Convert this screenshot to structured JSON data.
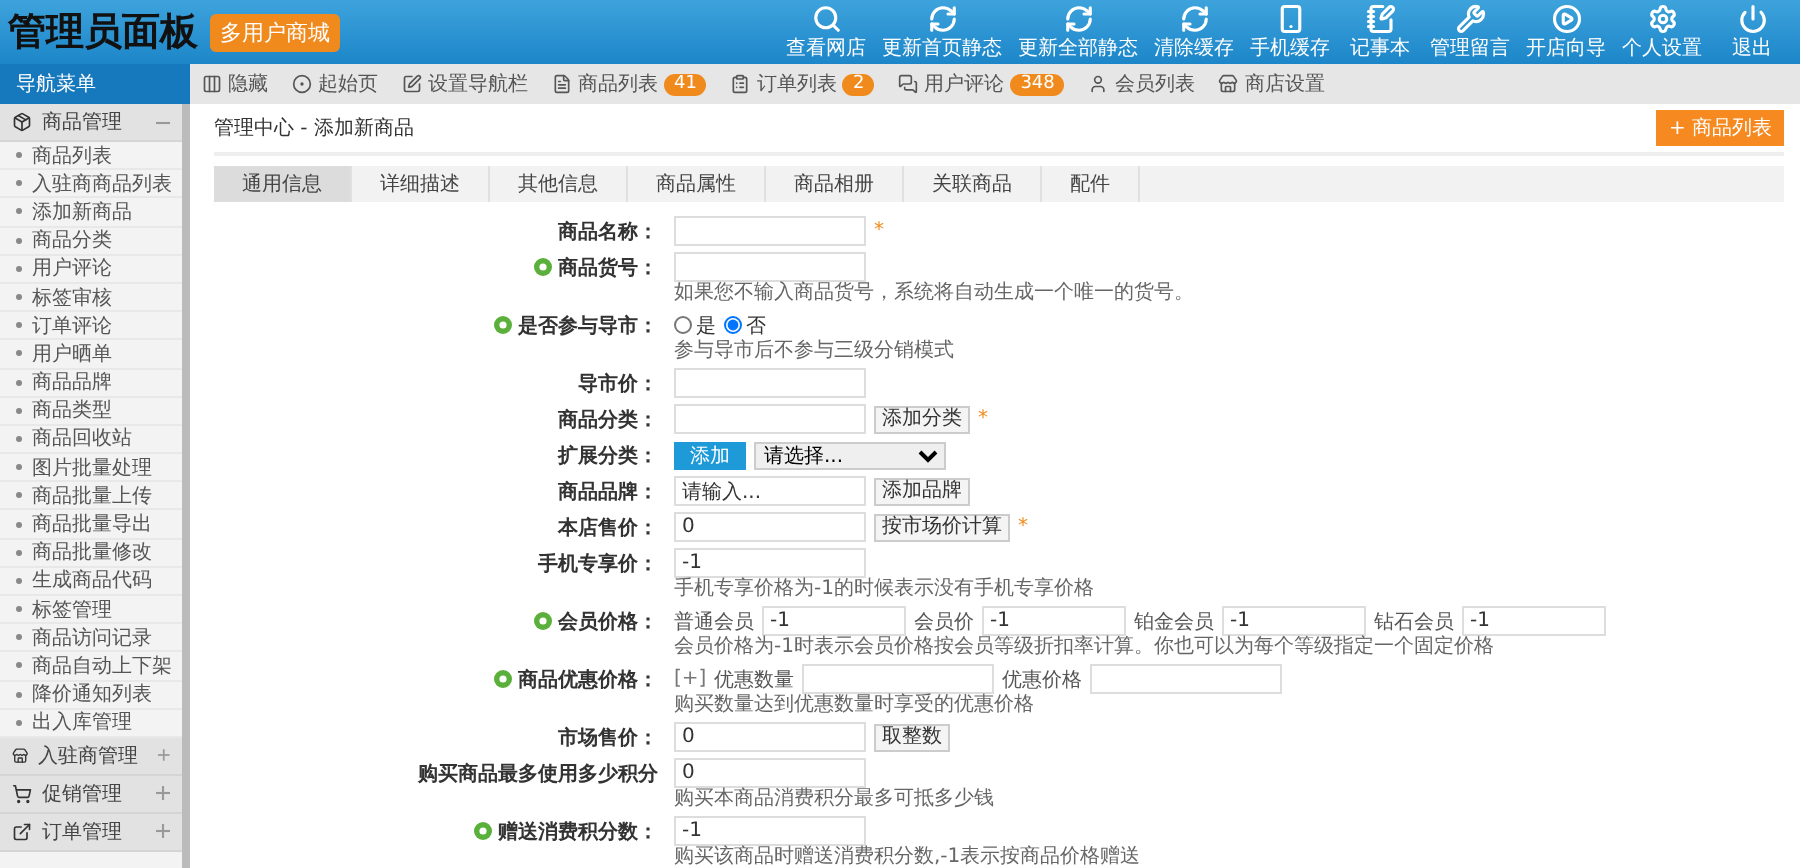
{
  "header": {
    "title": "管理员面板",
    "badge": "多用户商城",
    "actions": [
      {
        "kind": "search",
        "label": "查看网店"
      },
      {
        "kind": "refresh",
        "label": "更新首页静态"
      },
      {
        "kind": "refresh",
        "label": "更新全部静态"
      },
      {
        "kind": "refresh",
        "label": "清除缓存"
      },
      {
        "kind": "phone",
        "label": "手机缓存"
      },
      {
        "kind": "note",
        "label": "记事本"
      },
      {
        "kind": "wrench",
        "label": "管理留言"
      },
      {
        "kind": "play",
        "label": "开店向导"
      },
      {
        "kind": "gear",
        "label": "个人设置"
      },
      {
        "kind": "power",
        "label": "退出"
      }
    ]
  },
  "nav_title": "导航菜单",
  "toolbar": [
    {
      "kind": "hide",
      "label": "隐藏"
    },
    {
      "kind": "home",
      "label": "起始页"
    },
    {
      "kind": "edit",
      "label": "设置导航栏"
    },
    {
      "kind": "list",
      "label": "商品列表",
      "count": "41"
    },
    {
      "kind": "order",
      "label": "订单列表",
      "count": "2"
    },
    {
      "kind": "chat",
      "label": "用户评论",
      "count": "348"
    },
    {
      "kind": "member",
      "label": "会员列表"
    },
    {
      "kind": "shop",
      "label": "商店设置"
    }
  ],
  "sidebar": [
    {
      "kind": "goods",
      "title": "商品管理",
      "expanded": true,
      "items": [
        "商品列表",
        "入驻商商品列表",
        "添加新商品",
        "商品分类",
        "用户评论",
        "标签审核",
        "订单评论",
        "用户晒单",
        "商品品牌",
        "商品类型",
        "商品回收站",
        "图片批量处理",
        "商品批量上传",
        "商品批量导出",
        "商品批量修改",
        "生成商品代码",
        "标签管理",
        "商品访问记录",
        "商品自动上下架",
        "降价通知列表",
        "出入库管理"
      ]
    },
    {
      "kind": "store",
      "title": "入驻商管理",
      "expanded": false
    },
    {
      "kind": "cart",
      "title": "促销管理",
      "expanded": false
    },
    {
      "kind": "order",
      "title": "订单管理",
      "expanded": false
    }
  ],
  "breadcrumb": "管理中心 - 添加新商品",
  "list_button": "+ 商品列表",
  "tabs": [
    {
      "label": "通用信息",
      "selected": true
    },
    {
      "label": "详细描述",
      "selected": false
    },
    {
      "label": "其他信息",
      "selected": false
    },
    {
      "label": "商品属性",
      "selected": false
    },
    {
      "label": "商品相册",
      "selected": false
    },
    {
      "label": "关联商品",
      "selected": false
    },
    {
      "label": "配件",
      "selected": false
    }
  ],
  "form": [
    {
      "kind": "text",
      "label": "商品名称：",
      "help": false,
      "mark": "*"
    },
    {
      "kind": "text",
      "label": "商品货号：",
      "help": true,
      "hint": "如果您不输入商品货号，系统将自动生成一个唯一的货号。"
    },
    {
      "kind": "radio",
      "label": "是否参与导市：",
      "help": true,
      "options": [
        {
          "label": "是",
          "selected": false
        },
        {
          "label": "否",
          "selected": true
        }
      ],
      "hint": "参与导市后不参与三级分销模式"
    },
    {
      "kind": "text",
      "label": "导市价：",
      "help": false
    },
    {
      "kind": "text",
      "label": "商品分类：",
      "help": false,
      "button": "添加分类",
      "mark": "*"
    },
    {
      "kind": "select",
      "label": "扩展分类：",
      "help": false,
      "button": "添加",
      "value": "请选择..."
    },
    {
      "kind": "text",
      "label": "商品品牌：",
      "help": false,
      "value": "请输入...",
      "button": "添加品牌"
    },
    {
      "kind": "text",
      "label": "本店售价：",
      "help": false,
      "value": "0",
      "button": "按市场价计算",
      "mark": "*"
    },
    {
      "kind": "text",
      "label": "手机专享价：",
      "help": false,
      "value": "-1",
      "hint": "手机专享价格为-1的时候表示没有手机专享价格"
    },
    {
      "kind": "member",
      "label": "会员价格：",
      "help": true,
      "levels": [
        {
          "label": "普通会员",
          "value": "-1"
        },
        {
          "label": "会员价",
          "value": "-1"
        },
        {
          "label": "铂金会员",
          "value": "-1"
        },
        {
          "label": "钻石会员",
          "value": "-1"
        }
      ],
      "hint": "会员价格为-1时表示会员价格按会员等级折扣率计算。你也可以为每个等级指定一个固定价格"
    },
    {
      "kind": "discount",
      "label": "商品优惠价格：",
      "help": true,
      "link": "[+]",
      "fields": [
        "优惠数量",
        "优惠价格"
      ],
      "hint": "购买数量达到优惠数量时享受的优惠价格"
    },
    {
      "kind": "text",
      "label": "市场售价：",
      "help": false,
      "value": "0",
      "button": "取整数"
    },
    {
      "kind": "text",
      "label": "购买商品最多使用多少积分",
      "help": false,
      "value": "0",
      "hint": "购买本商品消费积分最多可抵多少钱"
    },
    {
      "kind": "text",
      "label": "赠送消费积分数：",
      "help": true,
      "value": "-1",
      "hint": "购买该商品时赠送消费积分数,-1表示按商品价格赠送"
    }
  ]
}
